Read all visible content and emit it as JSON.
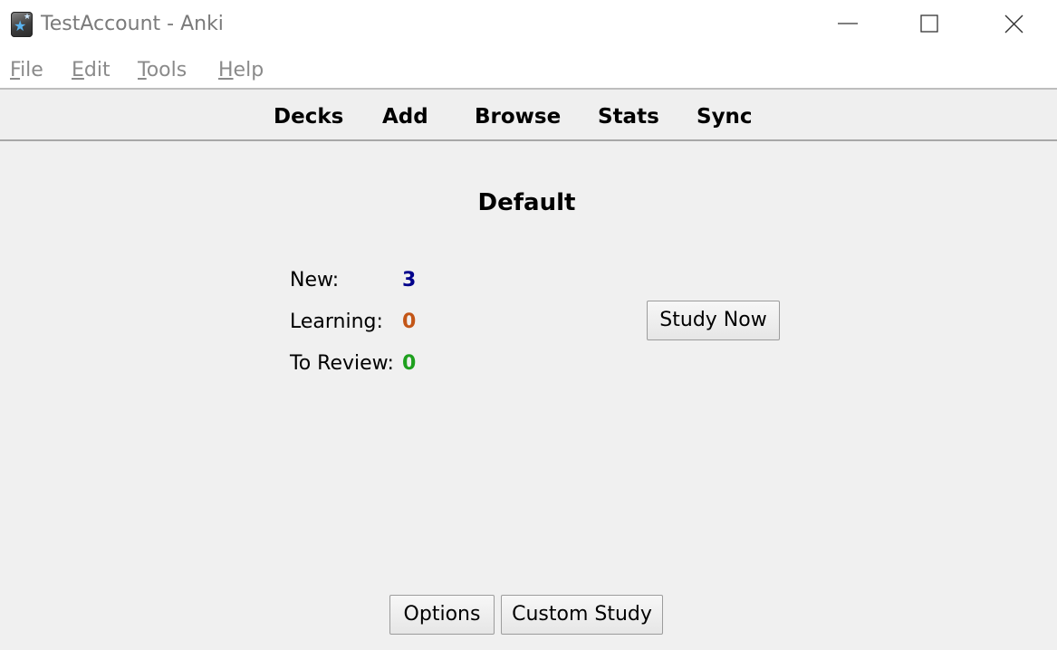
{
  "window": {
    "title": "TestAccount - Anki",
    "icon": "anki-app-icon"
  },
  "menu": {
    "items": [
      {
        "label": "File",
        "mnemonic": "F",
        "rest": "ile"
      },
      {
        "label": "Edit",
        "mnemonic": "E",
        "rest": "dit"
      },
      {
        "label": "Tools",
        "mnemonic": "T",
        "rest": "ools"
      },
      {
        "label": "Help",
        "mnemonic": "H",
        "rest": "elp"
      }
    ]
  },
  "toolbar": {
    "decks": "Decks",
    "add": "Add",
    "browse": "Browse",
    "stats": "Stats",
    "sync": "Sync"
  },
  "deck": {
    "name": "Default",
    "new_label": "New:",
    "new_count": "3",
    "learning_label": "Learning:",
    "learning_count": "0",
    "review_label": "To Review:",
    "review_count": "0",
    "study_now": "Study Now",
    "options": "Options",
    "custom_study": "Custom Study"
  },
  "colors": {
    "new": "#00008b",
    "learning": "#c35617",
    "review": "#1ea01e"
  }
}
